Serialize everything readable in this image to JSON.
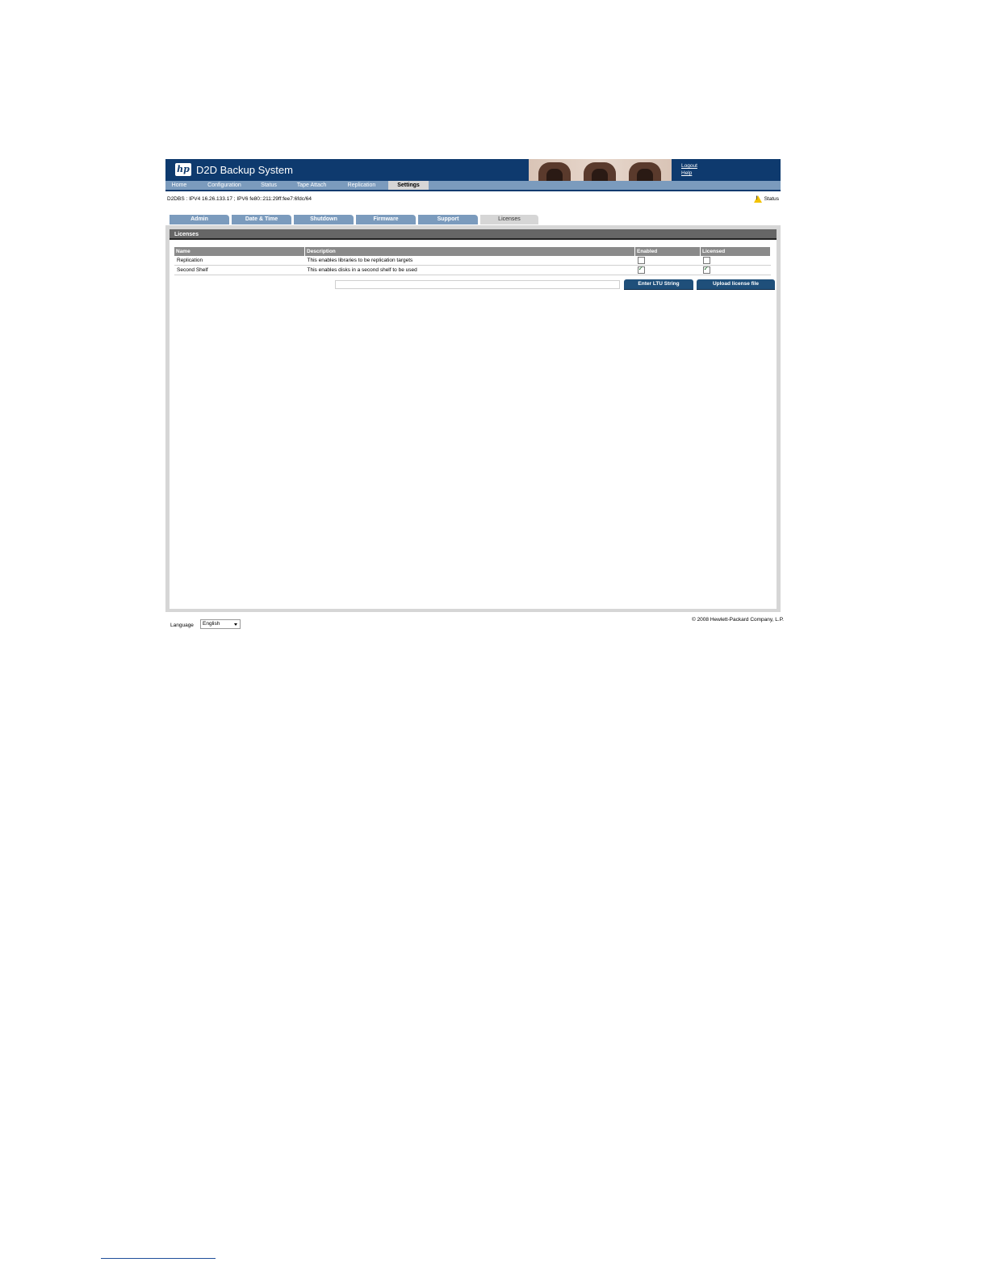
{
  "header": {
    "logo_text": "hp",
    "title": "D2D Backup System",
    "logout": "Logout",
    "help": "Help"
  },
  "nav": {
    "items": [
      {
        "label": "Home"
      },
      {
        "label": "Configuration"
      },
      {
        "label": "Status"
      },
      {
        "label": "Tape Attach"
      },
      {
        "label": "Replication"
      },
      {
        "label": "Settings"
      }
    ],
    "active": "Settings"
  },
  "system": {
    "info": "D2DBS : IPV4 16.26.133.17 ; IPV6 fe80::211:29ff:fee7:6fdc/64",
    "status_label": "Status",
    "status_icon": "warning-icon"
  },
  "subtabs": {
    "items": [
      {
        "label": "Admin"
      },
      {
        "label": "Date & Time"
      },
      {
        "label": "Shutdown"
      },
      {
        "label": "Firmware"
      },
      {
        "label": "Support"
      },
      {
        "label": "Licenses"
      }
    ],
    "active": "Licenses"
  },
  "licenses": {
    "section_title": "Licenses",
    "columns": {
      "name": "Name",
      "description": "Description",
      "enabled": "Enabled",
      "licensed": "Licensed"
    },
    "rows": [
      {
        "name": "Replication",
        "description": "This enables libraries to be replication targets",
        "enabled": false,
        "licensed": false
      },
      {
        "name": "Second Shelf",
        "description": "This enables disks in a second shelf to be used",
        "enabled": true,
        "licensed": true
      }
    ],
    "ltu_input_value": "",
    "enter_button": "Enter LTU String",
    "upload_button": "Upload license file"
  },
  "footer": {
    "language_label": "Language",
    "language_selected": "English",
    "copyright": "© 2008 Hewlett-Packard Company, L.P."
  },
  "colors": {
    "header_bg": "#0e3a6e",
    "nav_bg": "#7b9bbd",
    "button_bg": "#1f4f7a",
    "section_header_bg": "#666666"
  }
}
